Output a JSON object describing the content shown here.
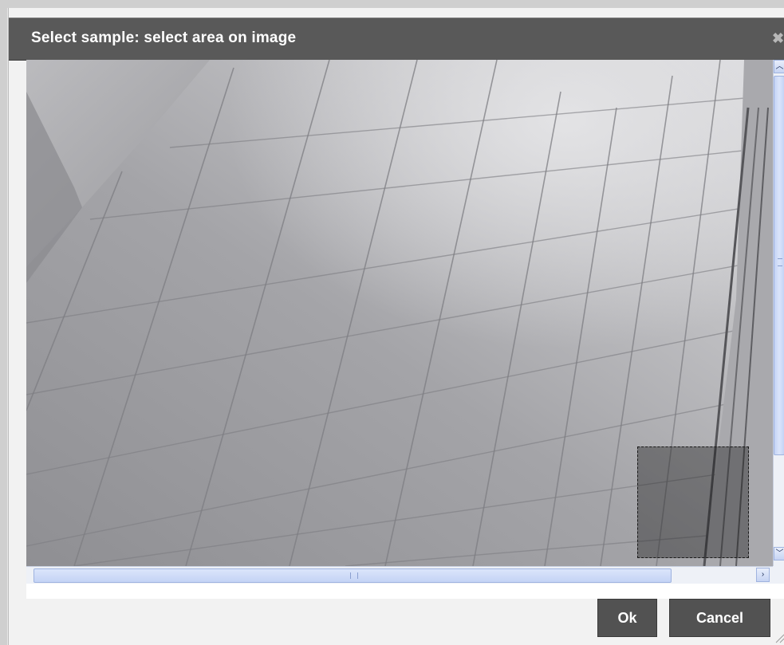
{
  "dialog": {
    "title": "Select sample: select area on image",
    "close_icon": "close-icon"
  },
  "viewer": {
    "image_alt": "grayscale camera view of a tiled floor",
    "selection": "sample-selection-rectangle"
  },
  "scrollbars": {
    "vertical": {
      "up_icon": "chevron-up-icon",
      "down_icon": "chevron-down-icon"
    },
    "horizontal": {
      "left_icon": "chevron-left-icon",
      "right_icon": "chevron-right-icon"
    }
  },
  "buttons": {
    "ok_label": "Ok",
    "cancel_label": "Cancel"
  },
  "colors": {
    "titlebar": "#595959",
    "button_bg": "#525252",
    "scrollbar_accent": "#c4d3f5"
  }
}
